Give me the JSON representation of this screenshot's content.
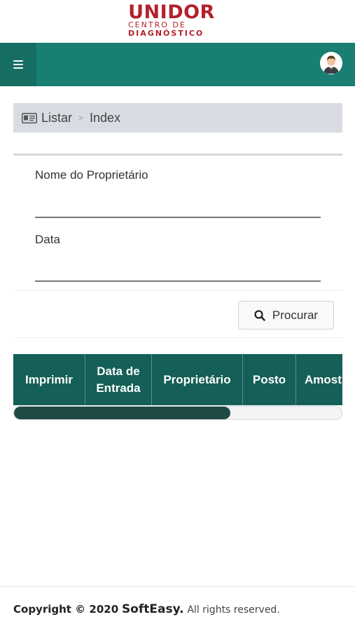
{
  "logo": {
    "main": "UNIDOR",
    "sub_line1": "CENTRO DE",
    "sub_line2": "DIAGNÓSTICO"
  },
  "topbar": {
    "menu_icon": "hamburger-icon",
    "avatar_icon": "user-avatar-icon",
    "color": "#1a7f73"
  },
  "breadcrumb": {
    "icon": "id-card-icon",
    "items": [
      "Listar",
      "Index"
    ],
    "separator": ">"
  },
  "form": {
    "owner_label": "Nome do Proprietário",
    "owner_value": "",
    "date_label": "Data",
    "date_value": "",
    "search_button": "Procurar",
    "search_icon": "magnifier-icon"
  },
  "table": {
    "columns": [
      "Imprimir",
      "Data de Entrada",
      "Proprietário",
      "Posto",
      "Amost"
    ],
    "header_color": "#145f57",
    "scroll_position": 0.66
  },
  "footer": {
    "copyright": "Copyright © 2020",
    "brand": "SoftEasy.",
    "rights": "All rights reserved."
  }
}
